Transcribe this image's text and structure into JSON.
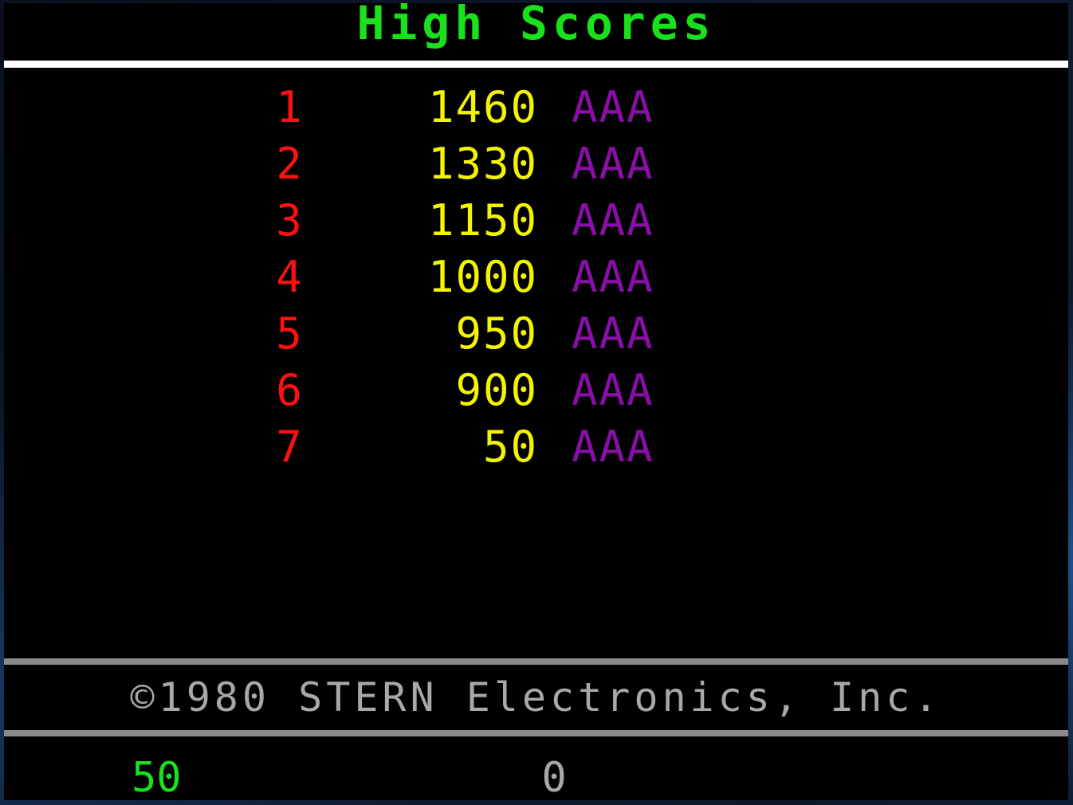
{
  "header": {
    "title": "High Scores"
  },
  "high_scores": [
    {
      "rank": "1",
      "score": "1460",
      "initials": "AAA"
    },
    {
      "rank": "2",
      "score": "1330",
      "initials": "AAA"
    },
    {
      "rank": "3",
      "score": "1150",
      "initials": "AAA"
    },
    {
      "rank": "4",
      "score": "1000",
      "initials": "AAA"
    },
    {
      "rank": "5",
      "score": "950",
      "initials": "AAA"
    },
    {
      "rank": "6",
      "score": "900",
      "initials": "AAA"
    },
    {
      "rank": "7",
      "score": "50",
      "initials": "AAA"
    }
  ],
  "footer": {
    "copyright": "©1980 STERN Electronics, Inc.",
    "player1_score": "50",
    "player2_score": "0"
  },
  "colors": {
    "title": "#19e21c",
    "rank": "#ff1010",
    "score": "#f4f400",
    "initials": "#8a0fa8",
    "copyright": "#a8a8a8",
    "background": "#000000"
  }
}
